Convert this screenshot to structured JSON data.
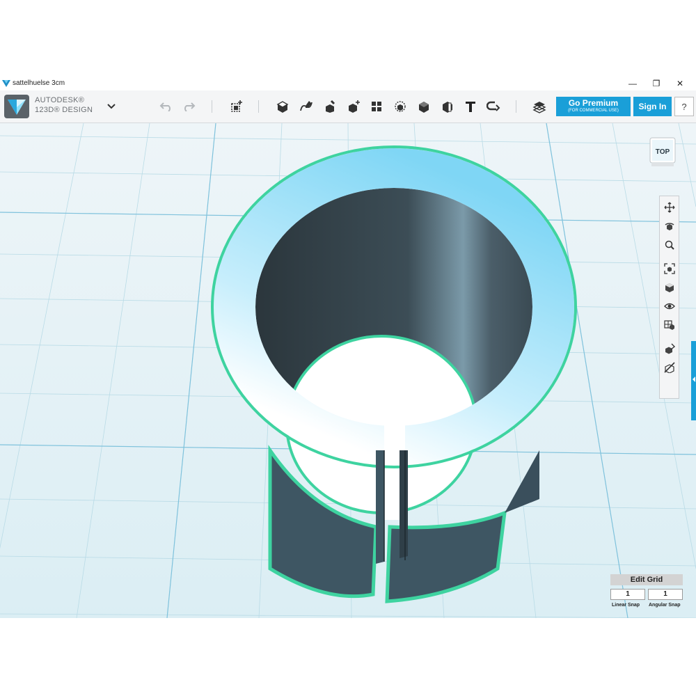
{
  "window": {
    "title": "sattelhuelse 3cm",
    "minimize": "—",
    "restore": "❐",
    "close": "✕"
  },
  "brand": {
    "line1": "AUTODESK®",
    "line2": "123D® DESIGN"
  },
  "toolbar": {
    "icons": [
      "undo-icon",
      "redo-icon",
      "primitives-icon",
      "sketch-icon",
      "construct-icon",
      "modify-icon",
      "pattern-icon",
      "grouping-icon",
      "combine-icon",
      "measure-icon",
      "text-icon",
      "snap-icon",
      "material-icon"
    ],
    "premium_label": "Go Premium",
    "premium_sub": "(FOR COMMERCIAL USE)",
    "signin_label": "Sign In",
    "help_label": "?"
  },
  "viewcube": {
    "face": "TOP"
  },
  "nav_panel": {
    "icons": [
      "pan-icon",
      "orbit-icon",
      "zoom-icon",
      "fit-icon",
      "view-icon",
      "visibility-icon",
      "materials-icon",
      "hide-sketch-icon",
      "hide-mesh-icon"
    ]
  },
  "edit_grid": {
    "title": "Edit Grid",
    "linear_value": "1",
    "angular_value": "1",
    "linear_label": "Linear Snap",
    "angular_label": "Angular Snap"
  },
  "colors": {
    "accent": "#1a9fd8",
    "selection": "#3ed3a0",
    "part_top": "#7fd6f5",
    "part_side": "#3f5866",
    "grid_bg": "#dfeff4"
  }
}
